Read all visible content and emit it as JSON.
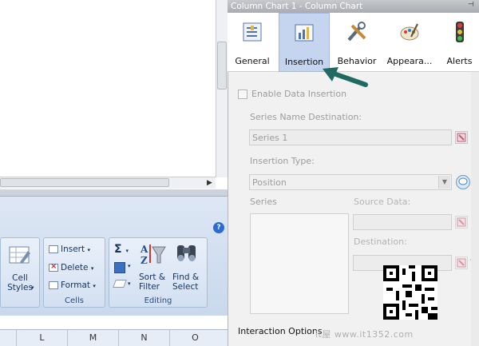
{
  "panel": {
    "title": "Column Chart 1 - Column Chart",
    "tabs": [
      {
        "label": "General",
        "icon": "general-icon"
      },
      {
        "label": "Insertion",
        "icon": "insertion-icon",
        "active": true
      },
      {
        "label": "Behavior",
        "icon": "behavior-icon"
      },
      {
        "label": "Appeara...",
        "icon": "appearance-icon"
      },
      {
        "label": "Alerts",
        "icon": "alerts-icon"
      }
    ],
    "enable_data_insertion": {
      "label": "Enable Data Insertion",
      "checked": false
    },
    "series_name_destination": {
      "label": "Series Name Destination:",
      "value": "Series 1"
    },
    "insertion_type": {
      "label": "Insertion Type:",
      "value": "Position"
    },
    "series_label": "Series",
    "source_data_label": "Source Data:",
    "destination_label": "Destination:",
    "interaction_options_label": "Interaction Options"
  },
  "ribbon": {
    "help": "?",
    "cell_styles": "Cell\nStyles",
    "cells": {
      "insert": "Insert",
      "delete": "Delete",
      "format": "Format",
      "group_label": "Cells"
    },
    "editing": {
      "sigma": "Σ",
      "sort_filter": "Sort &\nFilter",
      "find_select": "Find &\nSelect",
      "group_label": "Editing"
    }
  },
  "grid": {
    "columns": [
      "L",
      "M",
      "N",
      "O"
    ]
  },
  "watermark": "it屋 www.it1352.com",
  "colors": {
    "accent": "#2b6ad2",
    "active_tab": "#c6d5ef",
    "arrow": "#1f6b63"
  }
}
